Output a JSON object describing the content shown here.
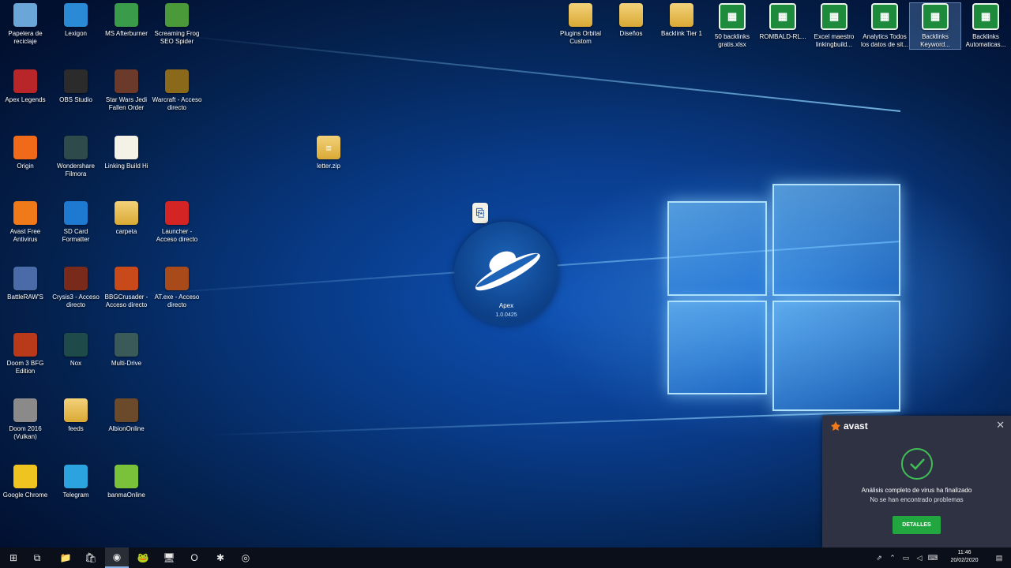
{
  "desktop_icons_left": [
    {
      "label": "Papelera de reciclaje",
      "icon": "recycle-bin-icon",
      "color": "#6aa6d8"
    },
    {
      "label": "Lexigon",
      "icon": "lexigon-icon",
      "color": "#2a8ad6"
    },
    {
      "label": "MS Afterburner",
      "icon": "afterburner-icon",
      "color": "#3a9c4a"
    },
    {
      "label": "Screaming Frog SEO Spider",
      "icon": "frog-icon",
      "color": "#4a9a3a"
    },
    {
      "label": "Apex Legends",
      "icon": "apex-icon",
      "color": "#b8262a"
    },
    {
      "label": "OBS Studio",
      "icon": "obs-icon",
      "color": "#2b2b2b"
    },
    {
      "label": "Star Wars Jedi Fallen Order",
      "icon": "jedi-icon",
      "color": "#6b3a2a"
    },
    {
      "label": "Warcraft - Acceso directo",
      "icon": "warcraft-icon",
      "color": "#8a6a1a"
    },
    {
      "label": "Origin",
      "icon": "origin-icon",
      "color": "#f06a1a"
    },
    {
      "label": "Wondershare Filmora",
      "icon": "filmora-icon",
      "color": "#2f4a4a"
    },
    {
      "label": "Linking Build Hi",
      "icon": "doc-icon",
      "color": "#f4f1e6"
    },
    {
      "label": "Avast Free Antivirus",
      "icon": "avast-icon",
      "color": "#f07a1a"
    },
    {
      "label": "SD Card Formatter",
      "icon": "sdcard-icon",
      "color": "#1e7ad0"
    },
    {
      "label": "carpeta",
      "icon": "folder-icon",
      "color": "#e5bd4d"
    },
    {
      "label": "Launcher - Acceso directo",
      "icon": "launcher-icon",
      "color": "#d42424"
    },
    {
      "label": "BattleRAW'S",
      "icon": "battle-icon",
      "color": "#4a6aa8"
    },
    {
      "label": "Crysis3 - Acceso directo",
      "icon": "crysis-icon",
      "color": "#7a2a1a"
    },
    {
      "label": "BBGCrusader - Acceso directo",
      "icon": "crusader-icon",
      "color": "#c84a1a"
    },
    {
      "label": "AT.exe - Acceso directo",
      "icon": "at-icon",
      "color": "#a84a1a"
    },
    {
      "label": "Doom 3 BFG Edition",
      "icon": "doom-icon",
      "color": "#b83a1a"
    },
    {
      "label": "Nox",
      "icon": "nox-icon",
      "color": "#1f4a4a"
    },
    {
      "label": "Multi-Drive",
      "icon": "multidrive-icon",
      "color": "#3a5a5a"
    },
    {
      "label": "Doom 2016 (Vulkan)",
      "icon": "doom2016-icon",
      "color": "#8a8a8a"
    },
    {
      "label": "feeds",
      "icon": "folder-icon",
      "color": "#e5bd4d"
    },
    {
      "label": "AlbionOnline",
      "icon": "albion-icon",
      "color": "#6a4a2a"
    },
    {
      "label": "Google Chrome",
      "icon": "chrome-icon",
      "color": "#f0c420"
    },
    {
      "label": "Telegram",
      "icon": "telegram-icon",
      "color": "#2aa3df"
    },
    {
      "label": "banmaOnline",
      "icon": "cube-icon",
      "color": "#7ac23a"
    }
  ],
  "desktop_icons_top": [
    {
      "label": "Plugins Orbital Custom",
      "icon": "folder-icon"
    },
    {
      "label": "Diseños",
      "icon": "folder-icon"
    },
    {
      "label": "Backlink Tier 1",
      "icon": "folder-icon"
    },
    {
      "label": "50 backlinks gratis.xlsx",
      "icon": "spreadsheet-icon"
    },
    {
      "label": "ROMBALD-RL...",
      "icon": "spreadsheet-icon"
    },
    {
      "label": "Excel maestro linkingbuild...",
      "icon": "spreadsheet-icon"
    },
    {
      "label": "Analytics Todos los datos de sit...",
      "icon": "spreadsheet-icon"
    },
    {
      "label": "Backlinks Keyword...",
      "icon": "spreadsheet-icon",
      "selected": true
    },
    {
      "label": "Backlinks Automaticas...",
      "icon": "spreadsheet-icon"
    }
  ],
  "desktop_icons_middle": [
    {
      "label": "letter.zip",
      "icon": "zip-folder-icon"
    }
  ],
  "uploader_widget": {
    "name": "Apex",
    "version": "1.0.0425"
  },
  "avast_popup": {
    "brand": "avast",
    "message_line1": "Análisis completo de virus ha finalizado",
    "message_line2": "No se han encontrado problemas",
    "button": "DETALLES",
    "close": "✕",
    "accent": "#21a640"
  },
  "taskbar": {
    "items": [
      {
        "name": "start-button",
        "glyph": "⊞"
      },
      {
        "name": "task-view-button",
        "glyph": "⧉"
      },
      {
        "name": "file-explorer-taskbar",
        "glyph": "📁"
      },
      {
        "name": "store-taskbar",
        "glyph": "🛍"
      },
      {
        "name": "chrome-taskbar",
        "glyph": "◉",
        "active": true
      },
      {
        "name": "frog-taskbar",
        "glyph": "🐸"
      },
      {
        "name": "monitor-taskbar",
        "glyph": "🖥"
      },
      {
        "name": "opera-taskbar",
        "glyph": "O"
      },
      {
        "name": "avast-taskbar",
        "glyph": "✱"
      },
      {
        "name": "obs-taskbar",
        "glyph": "◎"
      }
    ],
    "clock_time": "11:46",
    "clock_date": "20/02/2020"
  }
}
